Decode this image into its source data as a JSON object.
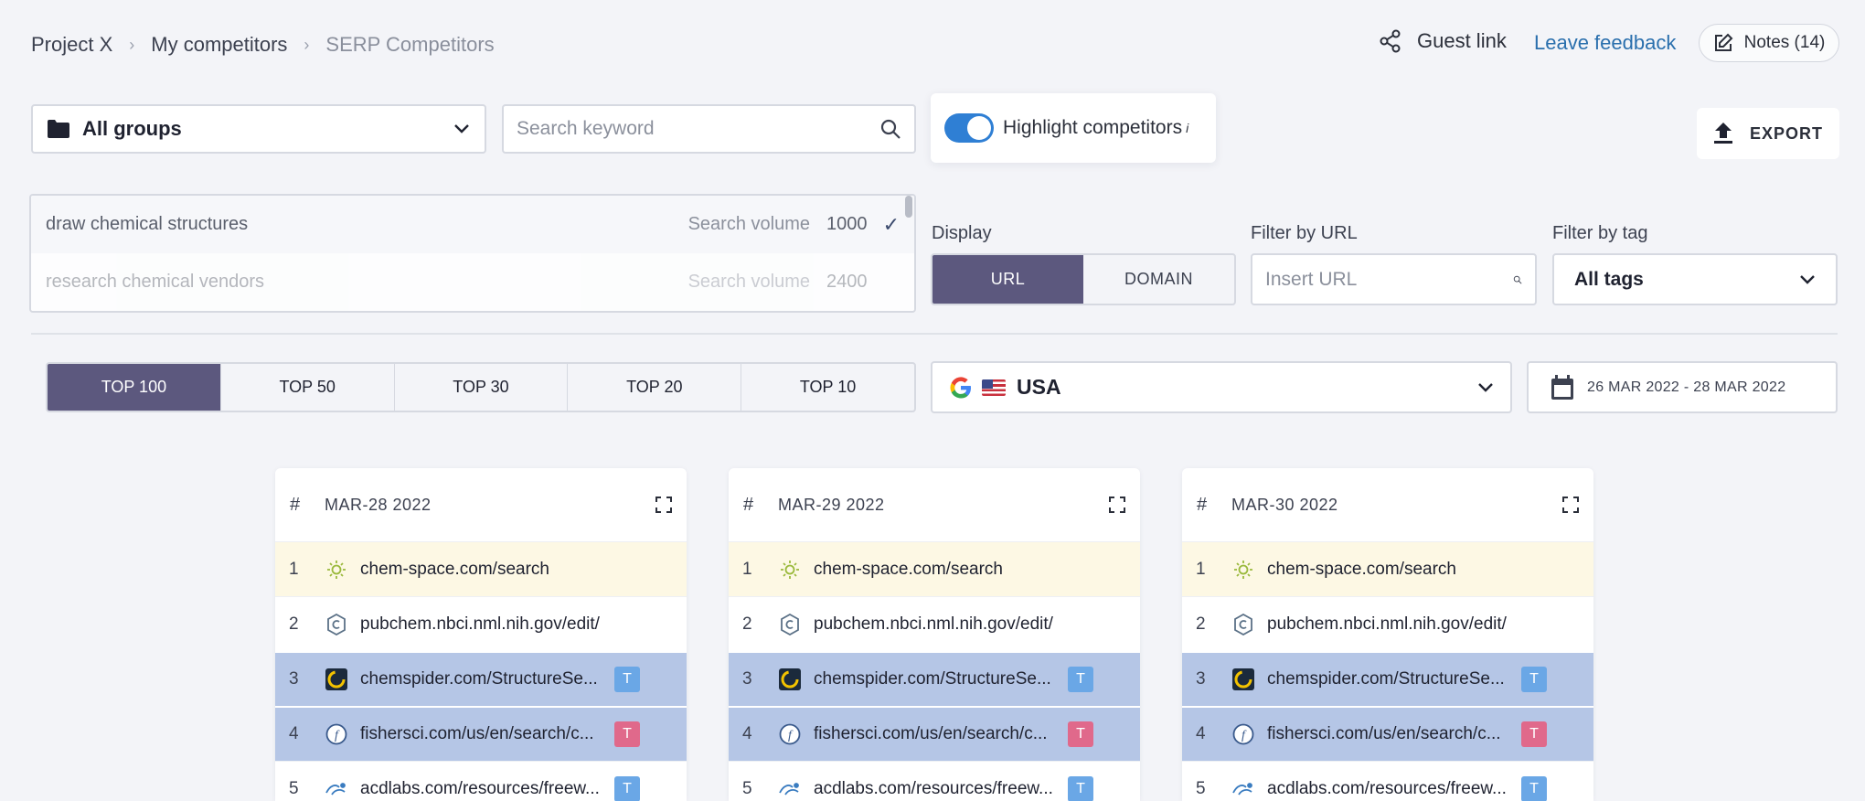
{
  "breadcrumb": [
    "Project X",
    "My competitors",
    "SERP Competitors"
  ],
  "header": {
    "guest_link": "Guest link",
    "feedback": "Leave feedback",
    "notes": "Notes (14)"
  },
  "groups": {
    "selected": "All groups"
  },
  "search": {
    "placeholder": "Search keyword"
  },
  "highlight": {
    "label": "Highlight competitors",
    "info": "i",
    "enabled": true
  },
  "export": {
    "label": "EXPORT"
  },
  "keywords": [
    {
      "keyword": "draw chemical structures",
      "sv_label": "Search volume",
      "volume": "1000",
      "selected": true
    },
    {
      "keyword": "research chemical vendors",
      "sv_label": "Search volume",
      "volume": "2400",
      "selected": false
    }
  ],
  "display": {
    "label": "Display",
    "options": [
      "URL",
      "DOMAIN"
    ],
    "active": "URL"
  },
  "filter_url": {
    "label": "Filter by URL",
    "placeholder": "Insert URL"
  },
  "filter_tag": {
    "label": "Filter by tag",
    "selected": "All tags"
  },
  "tops": {
    "options": [
      "TOP 100",
      "TOP 50",
      "TOP 30",
      "TOP 20",
      "TOP 10"
    ],
    "active": "TOP 100"
  },
  "country": {
    "selected": "USA"
  },
  "date_range": "26 MAR 2022 - 28 MAR 2022",
  "columns": [
    {
      "hash": "#",
      "date": "MAR-28 2022",
      "rows": [
        {
          "rank": "1",
          "url": "chem-space.com/search",
          "tag": ""
        },
        {
          "rank": "2",
          "url": "pubchem.nbci.nml.nih.gov/edit/",
          "tag": ""
        },
        {
          "rank": "3",
          "url": "chemspider.com/StructureSe...",
          "tag": "T"
        },
        {
          "rank": "4",
          "url": "fishersci.com/us/en/search/c...",
          "tag": "T"
        },
        {
          "rank": "5",
          "url": "acdlabs.com/resources/freew...",
          "tag": "T"
        }
      ]
    },
    {
      "hash": "#",
      "date": "MAR-29 2022",
      "rows": [
        {
          "rank": "1",
          "url": "chem-space.com/search",
          "tag": ""
        },
        {
          "rank": "2",
          "url": "pubchem.nbci.nml.nih.gov/edit/",
          "tag": ""
        },
        {
          "rank": "3",
          "url": "chemspider.com/StructureSe...",
          "tag": "T"
        },
        {
          "rank": "4",
          "url": "fishersci.com/us/en/search/c...",
          "tag": "T"
        },
        {
          "rank": "5",
          "url": "acdlabs.com/resources/freew...",
          "tag": "T"
        }
      ]
    },
    {
      "hash": "#",
      "date": "MAR-30 2022",
      "rows": [
        {
          "rank": "1",
          "url": "chem-space.com/search",
          "tag": ""
        },
        {
          "rank": "2",
          "url": "pubchem.nbci.nml.nih.gov/edit/",
          "tag": ""
        },
        {
          "rank": "3",
          "url": "chemspider.com/StructureSe...",
          "tag": "T"
        },
        {
          "rank": "4",
          "url": "fishersci.com/us/en/search/c...",
          "tag": "T"
        },
        {
          "rank": "5",
          "url": "acdlabs.com/resources/freew...",
          "tag": "T"
        }
      ]
    }
  ],
  "colors": {
    "accent": "#5c587e",
    "toggle": "#2f7fd4",
    "highlight_row": "#b5c6e6",
    "own_row": "#fdf8e4",
    "tag_blue": "#6aa7e6",
    "tag_pink": "#e0698b",
    "link": "#2a6fad"
  }
}
